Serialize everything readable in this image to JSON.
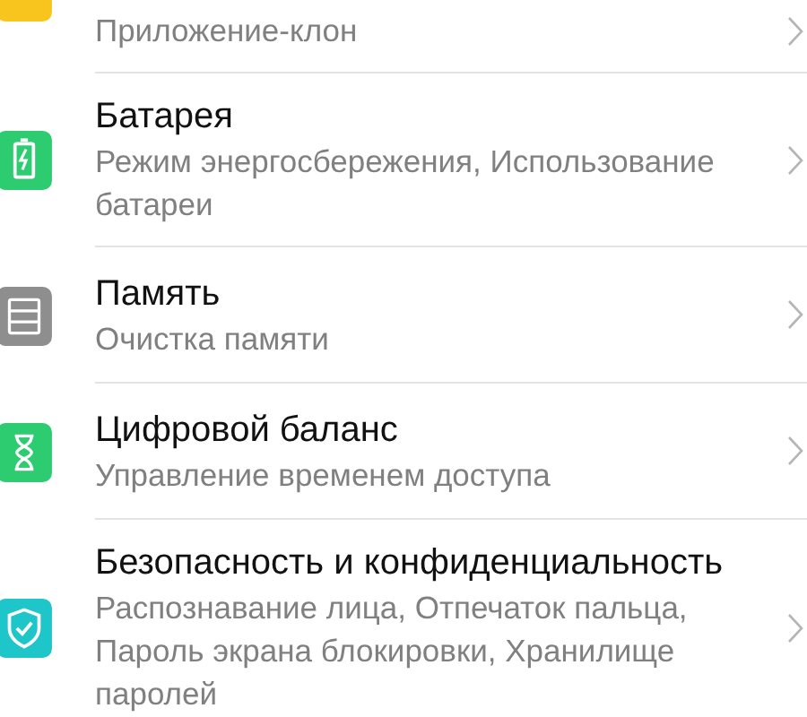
{
  "items": [
    {
      "color": "#f7c51e",
      "subtitle": "Приложение-клон"
    },
    {
      "color": "#2ecc71",
      "title": "Батарея",
      "subtitle": "Режим энергосбережения, Использование батареи"
    },
    {
      "color": "#8e8e8e",
      "title": "Память",
      "subtitle": "Очистка памяти"
    },
    {
      "color": "#2ecc71",
      "title": "Цифровой баланс",
      "subtitle": "Управление временем доступа"
    },
    {
      "color": "#1fc6c9",
      "title": "Безопасность и конфиденциальность",
      "subtitle": "Распознавание лица, Отпечаток пальца, Пароль экрана блокировки, Хранилище паролей"
    }
  ]
}
